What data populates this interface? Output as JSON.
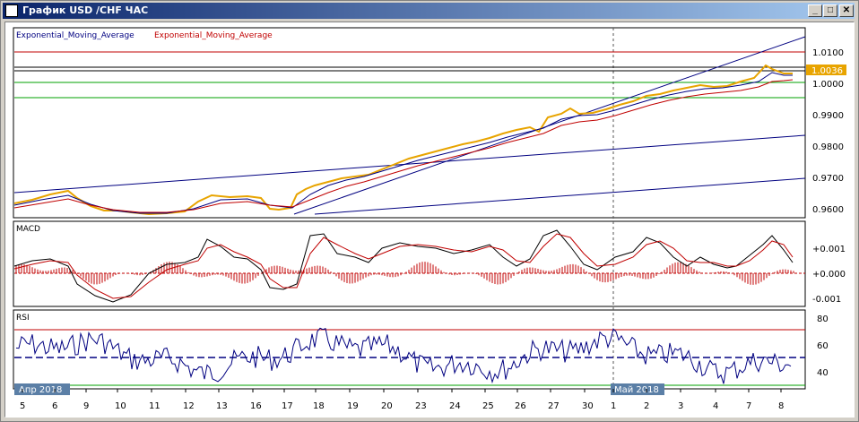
{
  "window": {
    "title": "График USD /CHF ЧАС",
    "minimize": "_",
    "restore": "□",
    "close": "✕"
  },
  "legend": {
    "ema1": "Exponential_Moving_Average",
    "ema2": "Exponential_Moving_Average"
  },
  "price_axis": {
    "ticks": [
      "1.0100",
      "1.0000",
      "0.9900",
      "0.9800",
      "0.9700",
      "0.9600"
    ],
    "current": "1.0036"
  },
  "macd": {
    "label": "MACD",
    "ticks": [
      "+0.001",
      "+0.000",
      "-0.001"
    ]
  },
  "rsi": {
    "label": "RSI",
    "ticks": [
      "80",
      "60",
      "40"
    ],
    "upper": 70,
    "lower": 30,
    "mid": 50
  },
  "months": [
    "Апр 2018",
    "Май 2018"
  ],
  "dates": [
    "5",
    "6",
    "9",
    "10",
    "11",
    "12",
    "13",
    "16",
    "17",
    "18",
    "19",
    "20",
    "23",
    "24",
    "25",
    "26",
    "27",
    "30",
    "1",
    "2",
    "3",
    "4",
    "7",
    "8"
  ],
  "colors": {
    "price": "#e8a400",
    "ema_fast": "#000080",
    "ema_slow": "#c00000",
    "hline_red": "#c00000",
    "hline_green": "#00a000",
    "trend": "#000080"
  }
}
